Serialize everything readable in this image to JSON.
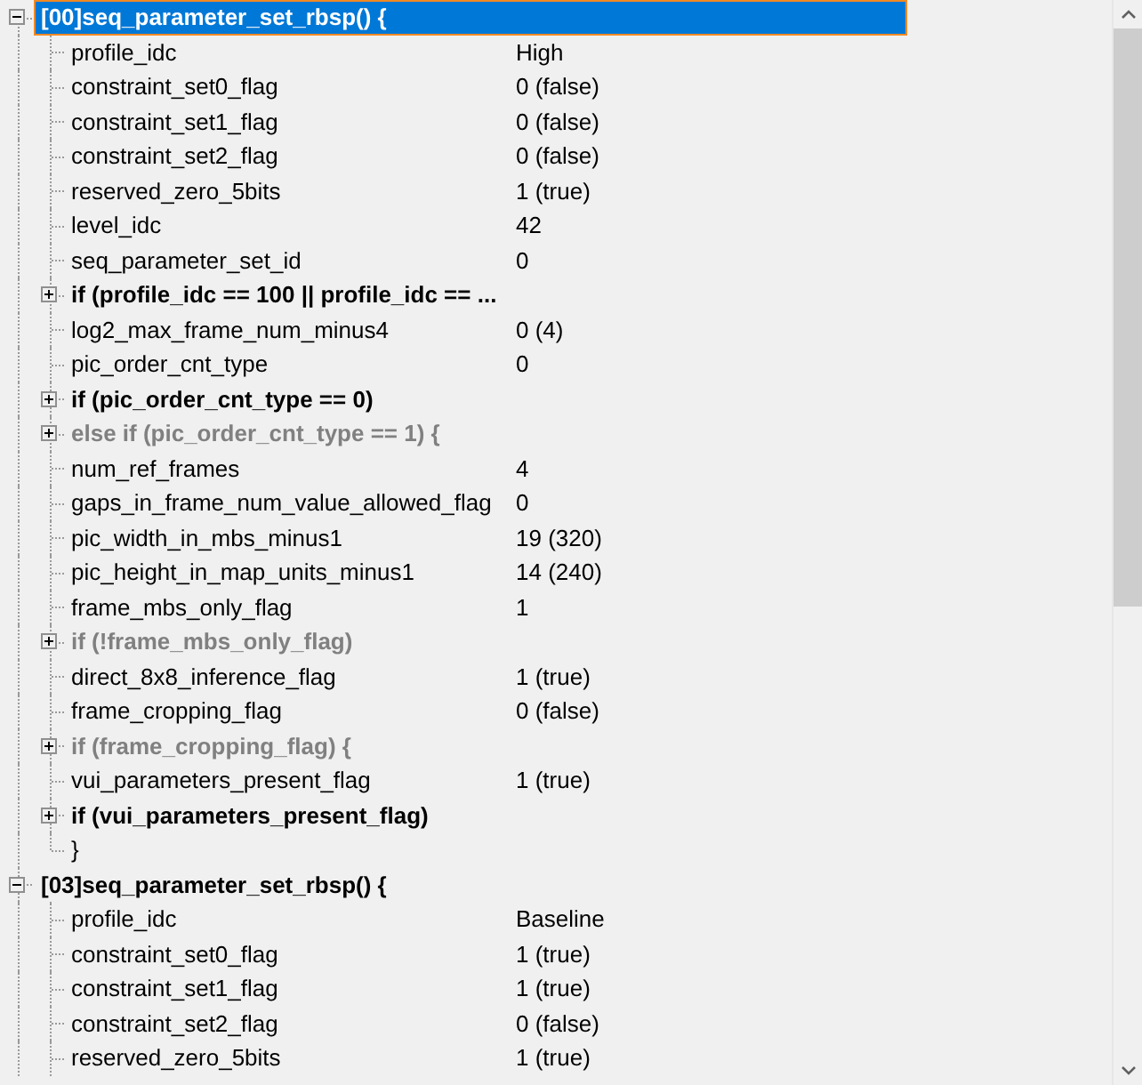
{
  "tree": [
    {
      "label": "[00]seq_parameter_set_rbsp() {",
      "selected": true,
      "expanded": true,
      "children": [
        {
          "kind": "field",
          "name": "profile_idc",
          "value": "High"
        },
        {
          "kind": "field",
          "name": "constraint_set0_flag",
          "value": "0 (false)"
        },
        {
          "kind": "field",
          "name": "constraint_set1_flag",
          "value": "0 (false)"
        },
        {
          "kind": "field",
          "name": "constraint_set2_flag",
          "value": "0 (false)"
        },
        {
          "kind": "field",
          "name": "reserved_zero_5bits",
          "value": "1 (true)"
        },
        {
          "kind": "field",
          "name": "level_idc",
          "value": "42"
        },
        {
          "kind": "field",
          "name": "seq_parameter_set_id",
          "value": "0"
        },
        {
          "kind": "branch",
          "name": "if (profile_idc == 100 || profile_idc == ...",
          "expanded": false,
          "disabled": false
        },
        {
          "kind": "field",
          "name": "log2_max_frame_num_minus4",
          "value": "0 (4)"
        },
        {
          "kind": "field",
          "name": "pic_order_cnt_type",
          "value": "0"
        },
        {
          "kind": "branch",
          "name": "if (pic_order_cnt_type == 0)",
          "expanded": false,
          "disabled": false
        },
        {
          "kind": "branch",
          "name": "else if (pic_order_cnt_type == 1) {",
          "expanded": false,
          "disabled": true
        },
        {
          "kind": "field",
          "name": "num_ref_frames",
          "value": "4"
        },
        {
          "kind": "field",
          "name": "gaps_in_frame_num_value_allowed_flag",
          "value": "0"
        },
        {
          "kind": "field",
          "name": "pic_width_in_mbs_minus1",
          "value": "19 (320)"
        },
        {
          "kind": "field",
          "name": "pic_height_in_map_units_minus1",
          "value": "14 (240)"
        },
        {
          "kind": "field",
          "name": "frame_mbs_only_flag",
          "value": "1"
        },
        {
          "kind": "branch",
          "name": "if (!frame_mbs_only_flag)",
          "expanded": false,
          "disabled": true
        },
        {
          "kind": "field",
          "name": "direct_8x8_inference_flag",
          "value": "1 (true)"
        },
        {
          "kind": "field",
          "name": "frame_cropping_flag",
          "value": "0 (false)"
        },
        {
          "kind": "branch",
          "name": "if (frame_cropping_flag) {",
          "expanded": false,
          "disabled": true
        },
        {
          "kind": "field",
          "name": "vui_parameters_present_flag",
          "value": "1 (true)"
        },
        {
          "kind": "branch",
          "name": "if (vui_parameters_present_flag)",
          "expanded": false,
          "disabled": false
        },
        {
          "kind": "end",
          "name": "}"
        }
      ]
    },
    {
      "label": "[03]seq_parameter_set_rbsp() {",
      "selected": false,
      "expanded": true,
      "children": [
        {
          "kind": "field",
          "name": "profile_idc",
          "value": "Baseline"
        },
        {
          "kind": "field",
          "name": "constraint_set0_flag",
          "value": "1 (true)"
        },
        {
          "kind": "field",
          "name": "constraint_set1_flag",
          "value": "1 (true)"
        },
        {
          "kind": "field",
          "name": "constraint_set2_flag",
          "value": "0 (false)"
        },
        {
          "kind": "field",
          "name": "reserved_zero_5bits",
          "value": "1 (true)"
        }
      ]
    }
  ]
}
